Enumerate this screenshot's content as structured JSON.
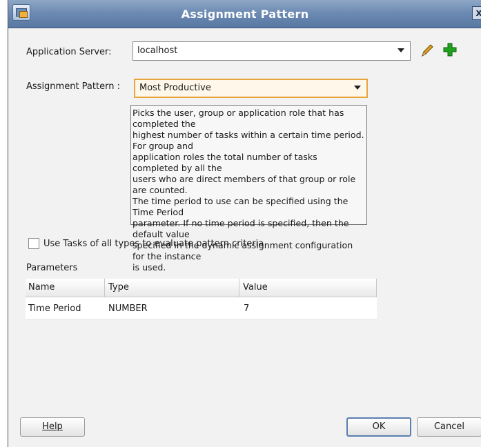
{
  "window": {
    "title": "Assignment Pattern",
    "close_glyph": "x"
  },
  "app_server": {
    "label": "Application Server:",
    "value": "localhost",
    "edit_icon": "pencil-icon",
    "add_icon": "plus-icon"
  },
  "assignment_pattern": {
    "label": "Assignment Pattern :",
    "value": "Most Productive"
  },
  "description": "Picks the user, group or application role that has completed the\nhighest number of tasks within a certain time period. For group and\napplication roles the total number of tasks completed by all the\nusers who are direct members of that group or role are counted.\nThe time period to use can be specified using the Time Period\nparameter. If no time period is specified, then the default value\nspecified in the dynamic assignment configuration for the instance\nis used.",
  "use_all_tasks": {
    "label": "Use Tasks of all types to evaluate pattern criteria",
    "checked": false
  },
  "parameters": {
    "heading": "Parameters",
    "columns": [
      "Name",
      "Type",
      "Value"
    ],
    "rows": [
      {
        "name": "Time Period",
        "type": "NUMBER",
        "value": "7"
      }
    ]
  },
  "buttons": {
    "help": "Help",
    "ok": "OK",
    "cancel": "Cancel"
  },
  "colors": {
    "title_bar": "#6d8bb3",
    "focus_border": "#e7a53e",
    "add_green": "#1fa31f"
  }
}
